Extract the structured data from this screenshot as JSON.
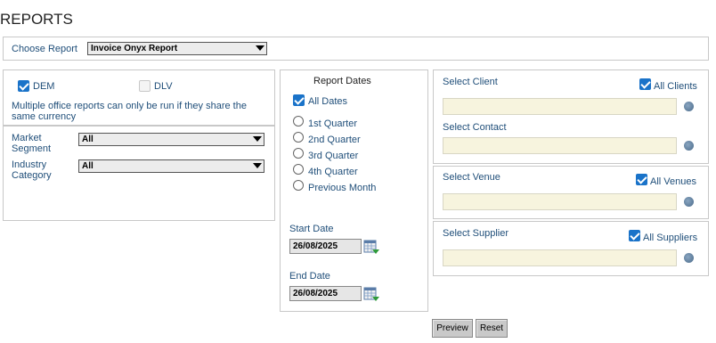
{
  "page": {
    "title": "REPORTS"
  },
  "choose_report": {
    "label": "Choose Report",
    "selected": "Invoice Onyx Report"
  },
  "offices": {
    "dem": {
      "label": "DEM",
      "checked": true
    },
    "dlv": {
      "label": "DLV",
      "checked": false
    },
    "note": "Multiple office reports can only be run if they share the same currency"
  },
  "filters": {
    "market_segment": {
      "label": "Market Segment",
      "selected": "All"
    },
    "industry_category": {
      "label": "Industry Category",
      "selected": "All"
    }
  },
  "report_dates": {
    "title": "Report Dates",
    "all_dates": {
      "label": "All Dates",
      "checked": true
    },
    "options": [
      "1st Quarter",
      "2nd Quarter",
      "3rd Quarter",
      "4th Quarter",
      "Previous Month"
    ],
    "start_date": {
      "label": "Start Date",
      "value": "26/08/2025"
    },
    "end_date": {
      "label": "End Date",
      "value": "26/08/2025"
    }
  },
  "client": {
    "label": "Select Client",
    "all_label": "All Clients",
    "all_checked": true
  },
  "contact": {
    "label": "Select Contact"
  },
  "venue": {
    "label": "Select Venue",
    "all_label": "All Venues",
    "all_checked": true
  },
  "supplier": {
    "label": "Select Supplier",
    "all_label": "All Suppliers",
    "all_checked": true
  },
  "actions": {
    "preview": "Preview",
    "reset": "Reset"
  },
  "colors": {
    "accent": "#1a73c9",
    "label_text": "#1f4e79",
    "field_bg": "#f7f4de",
    "panel_border": "#c8c8c8"
  }
}
